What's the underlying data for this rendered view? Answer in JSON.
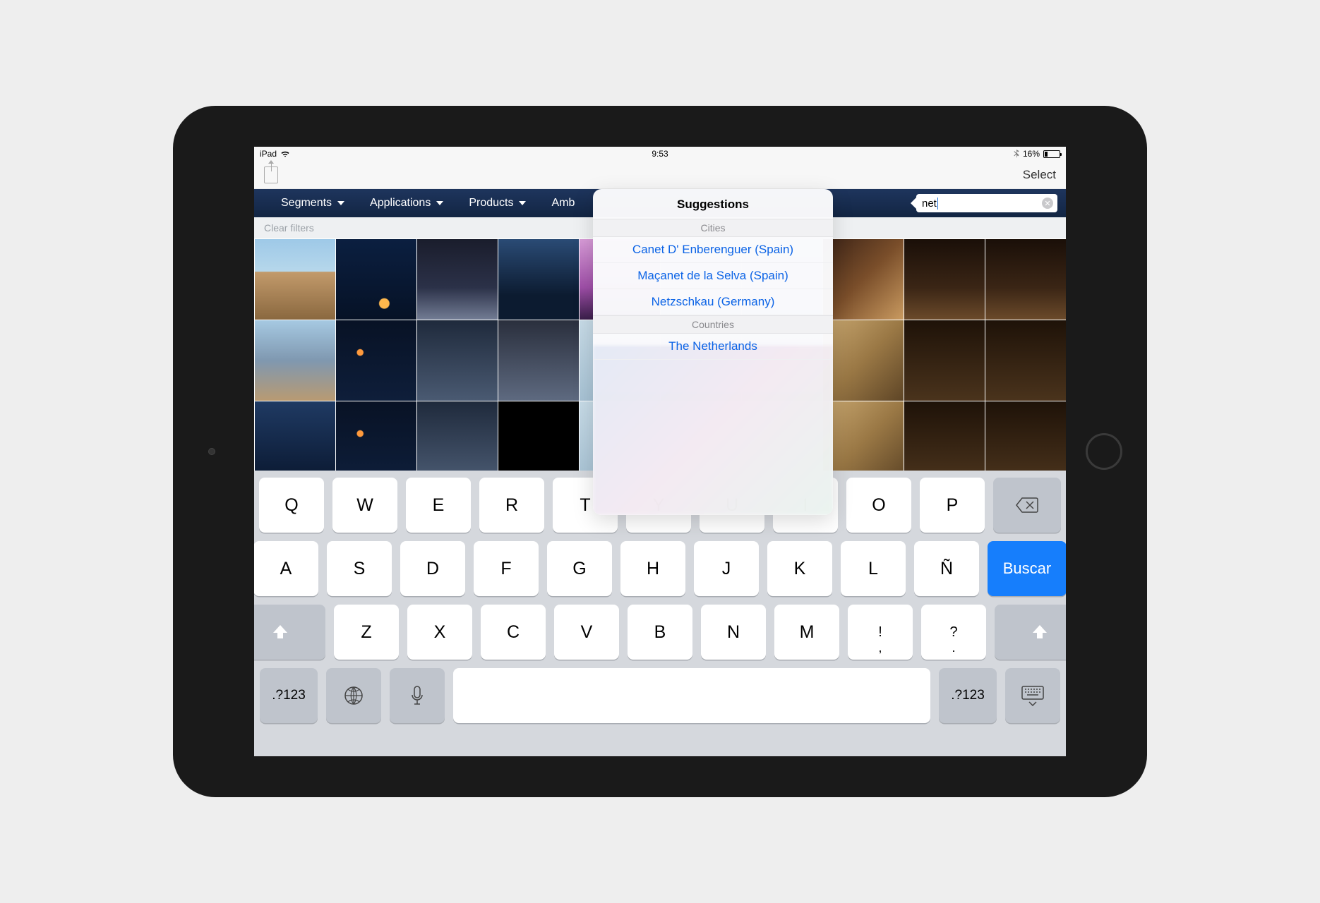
{
  "statusbar": {
    "device": "iPad",
    "time": "9:53",
    "battery_pct": "16%"
  },
  "toolbar": {
    "select_label": "Select"
  },
  "nav": {
    "items": [
      "Segments",
      "Applications",
      "Products",
      "Amb"
    ],
    "search_value": "net"
  },
  "subbar": {
    "clear_filters": "Clear filters"
  },
  "popover": {
    "title": "Suggestions",
    "section_cities": "Cities",
    "cities": [
      "Canet D' Enberenguer (Spain)",
      "Maçanet de la Selva (Spain)",
      "Netzschkau (Germany)"
    ],
    "section_countries": "Countries",
    "countries": [
      "The Netherlands"
    ]
  },
  "keyboard": {
    "row1": [
      "Q",
      "W",
      "E",
      "R",
      "T",
      "Y",
      "U",
      "I",
      "O",
      "P"
    ],
    "row2": [
      "A",
      "S",
      "D",
      "F",
      "G",
      "H",
      "J",
      "K",
      "L",
      "Ñ"
    ],
    "row3": [
      "Z",
      "X",
      "C",
      "V",
      "B",
      "N",
      "M"
    ],
    "row3_punct": [
      {
        "top": "!",
        "bottom": ","
      },
      {
        "top": "?",
        "bottom": "."
      }
    ],
    "search_label": "Buscar",
    "num_label": ".?123"
  }
}
